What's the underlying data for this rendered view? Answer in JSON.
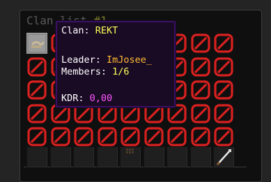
{
  "window": {
    "title": "Clan list",
    "title_number": "#1"
  },
  "grid": {
    "rows": 5,
    "cols": 9,
    "first_slot": "clan-banner",
    "other_slots": "barrier",
    "barrier_color": "#d92020"
  },
  "tooltip": {
    "clan_label": "Clan: ",
    "clan_value": "REKT",
    "leader_label": "Leader: ",
    "leader_value": "ImJosee_",
    "members_label": "Members: ",
    "members_value": "1/6",
    "kdr_label": "KDR: ",
    "kdr_value": "0,00"
  },
  "hotbar": {
    "last_item": "fishing-rod-icon"
  }
}
